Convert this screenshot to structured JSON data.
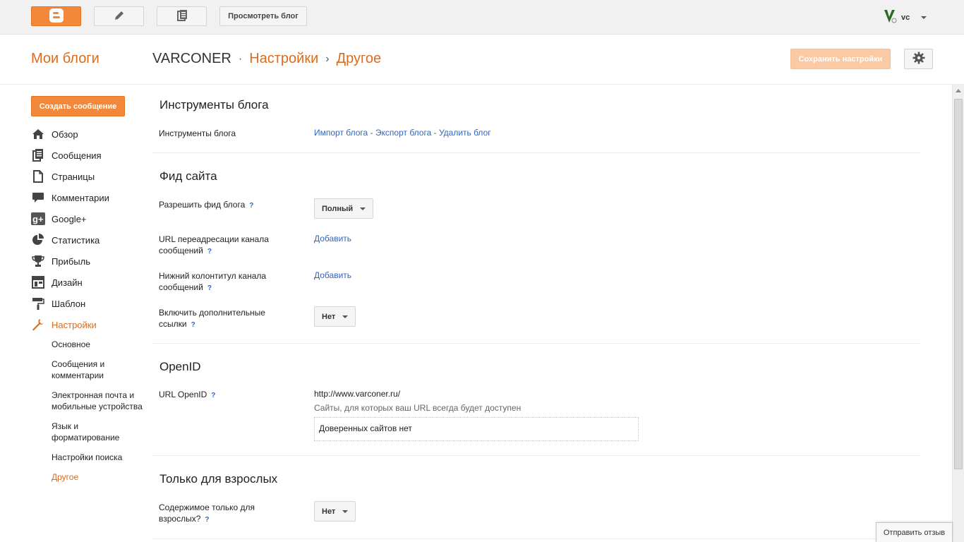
{
  "topbar": {
    "view_blog_label": "Просмотреть блог",
    "account_label": "vc",
    "icons": [
      "blogger-logo-icon",
      "pencil-icon",
      "pages-icon",
      "account-logo-icon"
    ]
  },
  "header": {
    "my_blogs": "Мои блоги",
    "blog_name": "VARCONER",
    "sep1": "·",
    "crumb_settings": "Настройки",
    "sep2": "›",
    "crumb_other": "Другое",
    "save_label": "Сохранить настройки"
  },
  "sidebar": {
    "create_post": "Создать сообщение",
    "items": [
      {
        "label": "Обзор",
        "icon": "home-icon"
      },
      {
        "label": "Сообщения",
        "icon": "posts-icon"
      },
      {
        "label": "Страницы",
        "icon": "page-icon"
      },
      {
        "label": "Комментарии",
        "icon": "comment-icon"
      },
      {
        "label": "Google+",
        "icon": "google-plus-icon"
      },
      {
        "label": "Статистика",
        "icon": "pie-chart-icon"
      },
      {
        "label": "Прибыль",
        "icon": "trophy-icon"
      },
      {
        "label": "Дизайн",
        "icon": "layout-icon"
      },
      {
        "label": "Шаблон",
        "icon": "paint-roller-icon"
      },
      {
        "label": "Настройки",
        "icon": "wrench-icon"
      }
    ],
    "sub_items": [
      "Основное",
      "Сообщения и комментарии",
      "Электронная почта и мобильные устройства",
      "Язык и форматирование",
      "Настройки поиска",
      "Другое"
    ]
  },
  "main": {
    "tools": {
      "title": "Инструменты блога",
      "label": "Инструменты блога",
      "import": "Импорт блога",
      "export": "Экспорт блога",
      "delete": "Удалить блог",
      "dash": "-"
    },
    "feed": {
      "title": "Фид сайта",
      "allow_label": "Разрешить фид блога",
      "allow_value": "Полный",
      "redirect_label": "URL переадресации канала сообщений",
      "redirect_action": "Добавить",
      "footer_label": "Нижний колонтитул канала сообщений",
      "footer_action": "Добавить",
      "extra_label": "Включить дополнительные ссылки",
      "extra_value": "Нет"
    },
    "openid": {
      "title": "OpenID",
      "label": "URL OpenID",
      "url": "http://www.varconer.ru/",
      "hint": "Сайты, для которых ваш URL всегда будет доступен",
      "trusted": "Доверенных сайтов нет"
    },
    "adult": {
      "title": "Только для взрослых",
      "label": "Содержимое только для взрослых?",
      "value": "Нет"
    },
    "help_mark": "?"
  },
  "feedback_label": "Отправить отзыв",
  "colors": {
    "accent": "#dd6b1e",
    "button_orange": "#f4883a",
    "link": "#3366bb"
  }
}
